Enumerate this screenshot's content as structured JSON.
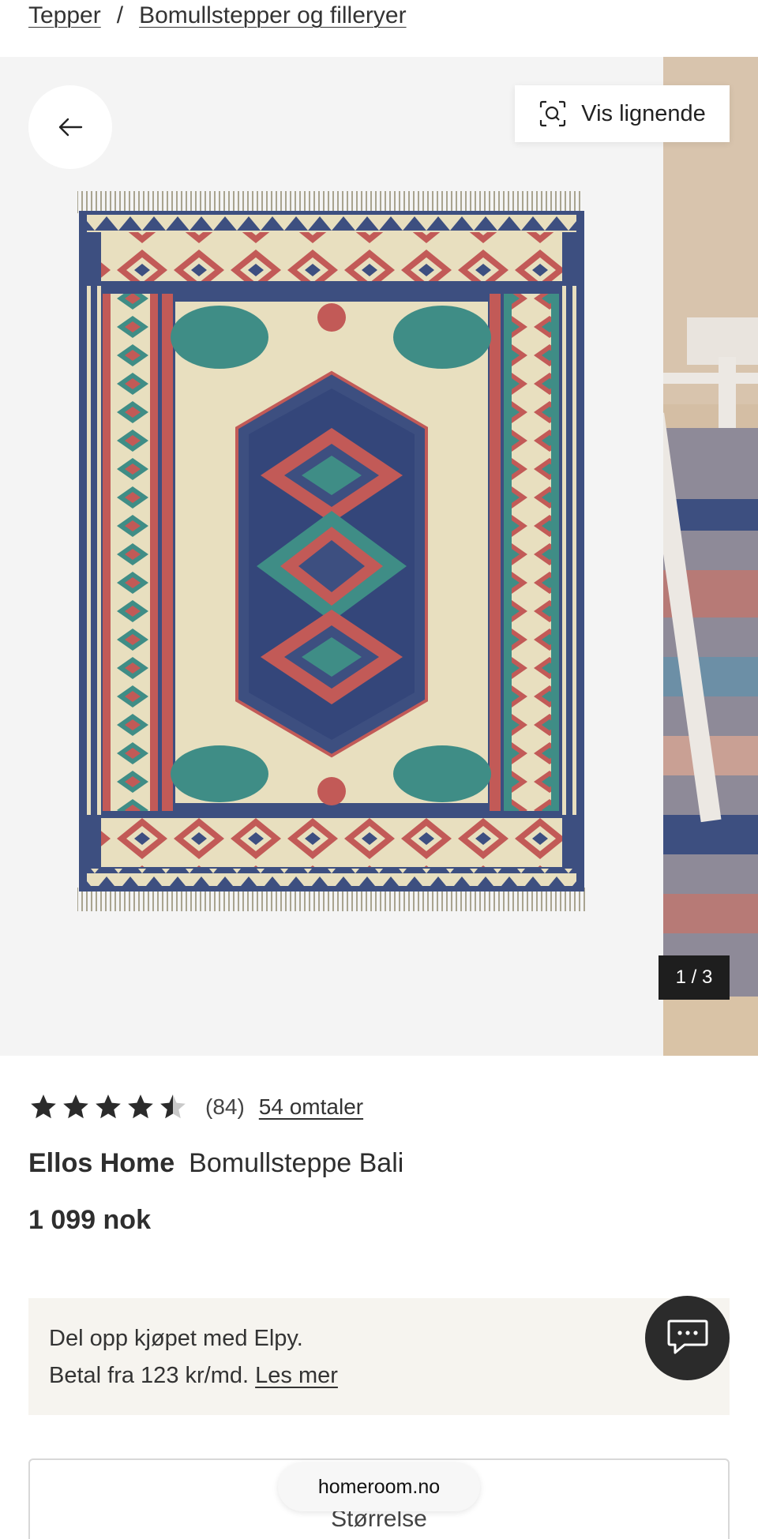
{
  "breadcrumb": {
    "items": [
      "Tepper",
      "Bomullstepper og filleryer"
    ],
    "separator": "/"
  },
  "gallery": {
    "vis_lignende_label": "Vis lignende",
    "counter": "1 / 3",
    "main_image_desc_icon": "rug-image",
    "back_icon": "arrow-left-icon"
  },
  "rating": {
    "stars": 4.5,
    "count": "(84)",
    "reviews_link": "54 omtaler"
  },
  "product": {
    "brand": "Ellos Home",
    "name": "Bomullsteppe Bali",
    "price": "1 099 nok"
  },
  "elpy": {
    "line1": "Del opp kjøpet med Elpy.",
    "line2": "Betal fra 123 kr/md.",
    "link": "Les mer"
  },
  "size_selector": {
    "label": "Størrelse"
  },
  "browser": {
    "url": "homeroom.no"
  },
  "colors": {
    "rug_blue": "#3d4f80",
    "rug_teal": "#3f8d86",
    "rug_red": "#c25a57",
    "rug_cream": "#e8dfbf"
  }
}
